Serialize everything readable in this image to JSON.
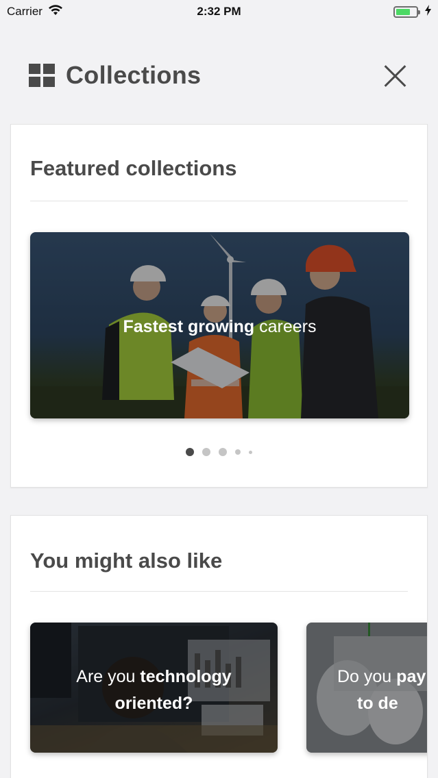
{
  "status_bar": {
    "carrier": "Carrier",
    "time": "2:32 PM",
    "battery_level": 0.72
  },
  "header": {
    "title": "Collections",
    "icon": "grid-icon",
    "close_icon": "close-icon"
  },
  "featured": {
    "title": "Featured collections",
    "banner": {
      "label_bold": "Fastest growing",
      "label_regular": " careers"
    },
    "pagination": {
      "total": 5,
      "active_index": 0
    }
  },
  "also_like": {
    "title": "You might also like",
    "items": [
      {
        "line1_regular": "Are you ",
        "line1_bold": "technology",
        "line2_bold": "oriented?"
      },
      {
        "line1_regular": "Do you ",
        "line1_bold": "pay",
        "line2_bold": "to de"
      }
    ]
  },
  "colors": {
    "background": "#f2f2f4",
    "text": "#4a4a4a",
    "battery": "#4cd964",
    "dot_active": "#4a4a4a",
    "dot_inactive": "#c5c5c5"
  }
}
